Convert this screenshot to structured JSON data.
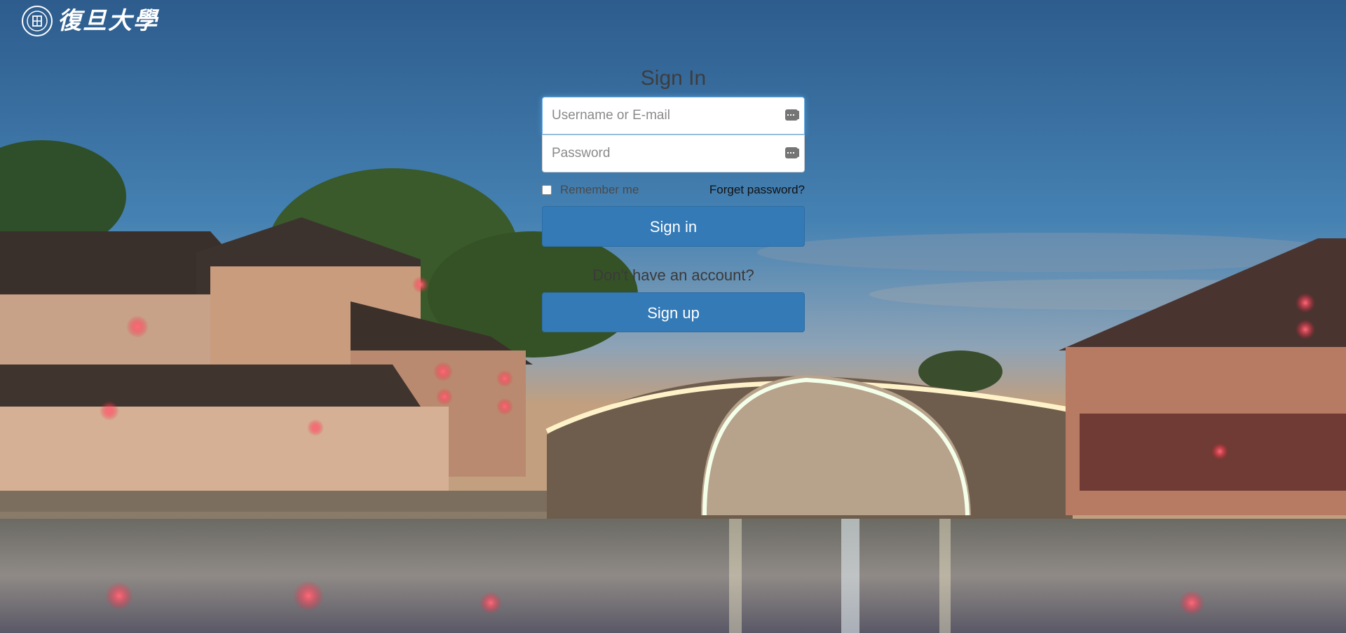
{
  "brand": {
    "logo_text": "復旦大學",
    "seal_icon": "university-seal-icon"
  },
  "login": {
    "title": "Sign In",
    "username_placeholder": "Username or E-mail",
    "password_placeholder": "Password",
    "field_icon": "key-icon",
    "remember_label": "Remember me",
    "forget_label": "Forget password?",
    "signin_label": "Sign in",
    "no_account_text": "Don't have an account?",
    "signup_label": "Sign up"
  },
  "colors": {
    "primary_button": "#337ab7",
    "focus_border": "#66afe9"
  }
}
